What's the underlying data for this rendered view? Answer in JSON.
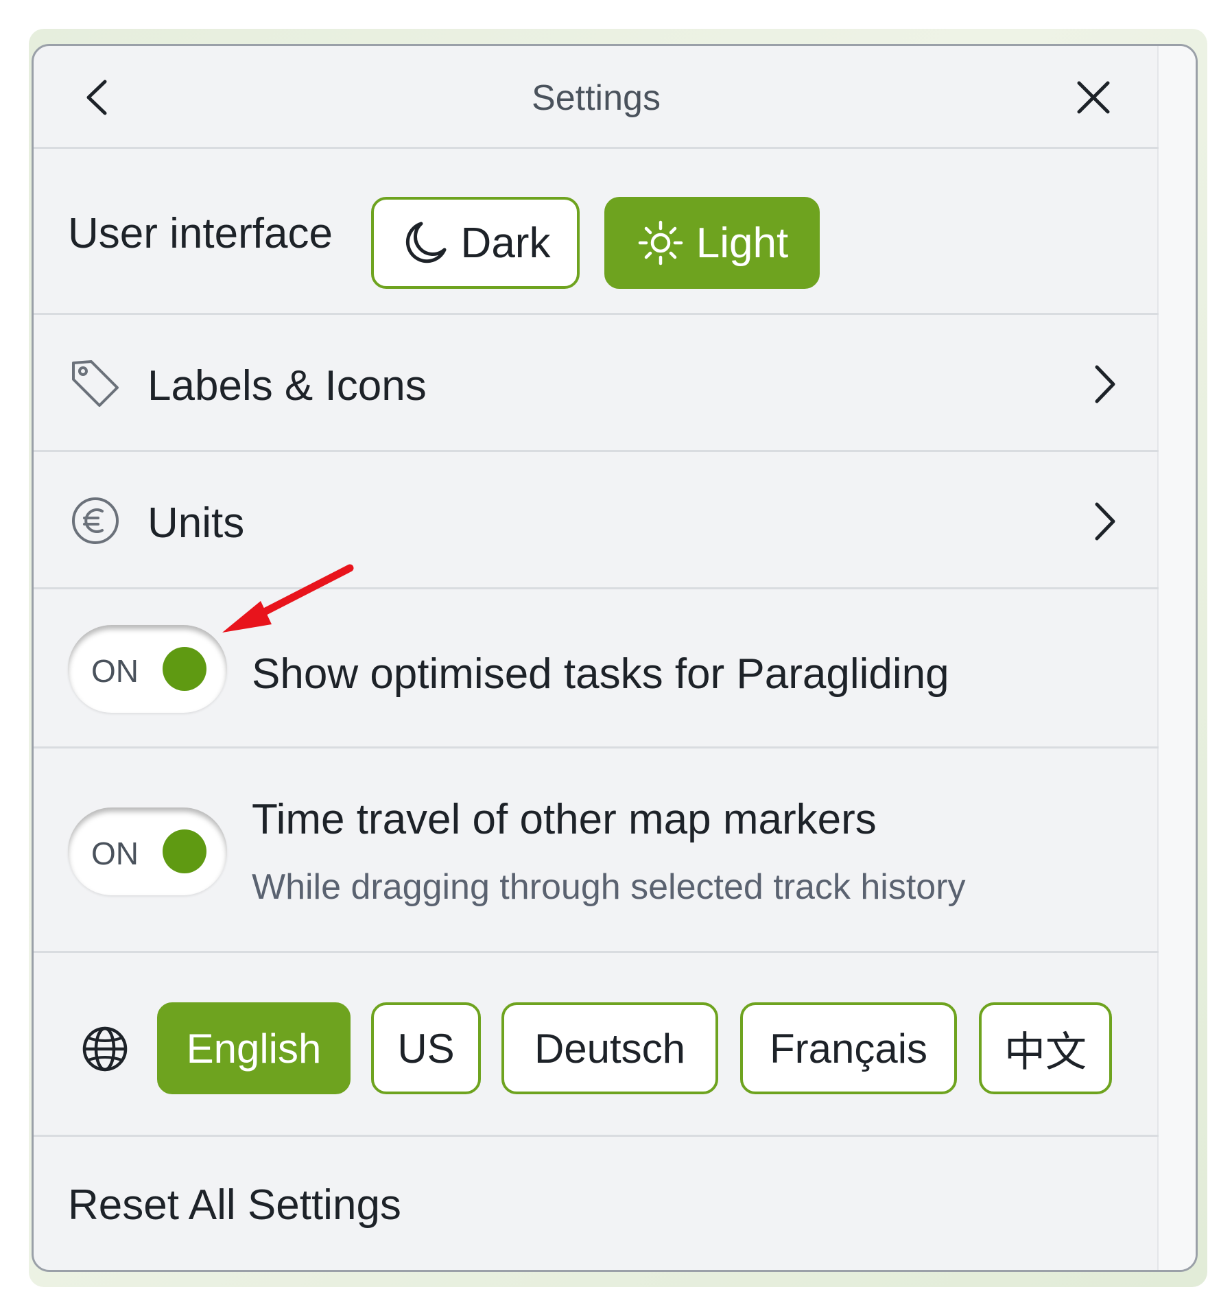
{
  "header": {
    "title": "Settings"
  },
  "user_interface": {
    "label": "User interface",
    "options": [
      {
        "label": "Dark",
        "icon": "moon-icon",
        "selected": false
      },
      {
        "label": "Light",
        "icon": "sun-icon",
        "selected": true
      }
    ]
  },
  "menu": {
    "labels_icons": {
      "label": "Labels & Icons",
      "icon": "tag-icon"
    },
    "units": {
      "label": "Units",
      "icon": "euro-circle-icon"
    }
  },
  "toggles": {
    "optimised_tasks": {
      "state_text": "ON",
      "label": "Show optimised tasks for Paragliding",
      "on": true
    },
    "time_travel": {
      "state_text": "ON",
      "label": "Time travel of other map markers",
      "sublabel": "While dragging through selected track history",
      "on": true
    }
  },
  "language": {
    "icon": "globe-icon",
    "options": [
      {
        "label": "English",
        "selected": true
      },
      {
        "label": "US",
        "selected": false
      },
      {
        "label": "Deutsch",
        "selected": false
      },
      {
        "label": "Français",
        "selected": false
      },
      {
        "label": "中文",
        "selected": false
      }
    ]
  },
  "reset": {
    "label": "Reset All Settings"
  },
  "colors": {
    "accent": "#6ea31f",
    "toggle_knob": "#5f9a12",
    "panel_bg": "#f2f3f5",
    "annotation_arrow": "#e8141c"
  }
}
